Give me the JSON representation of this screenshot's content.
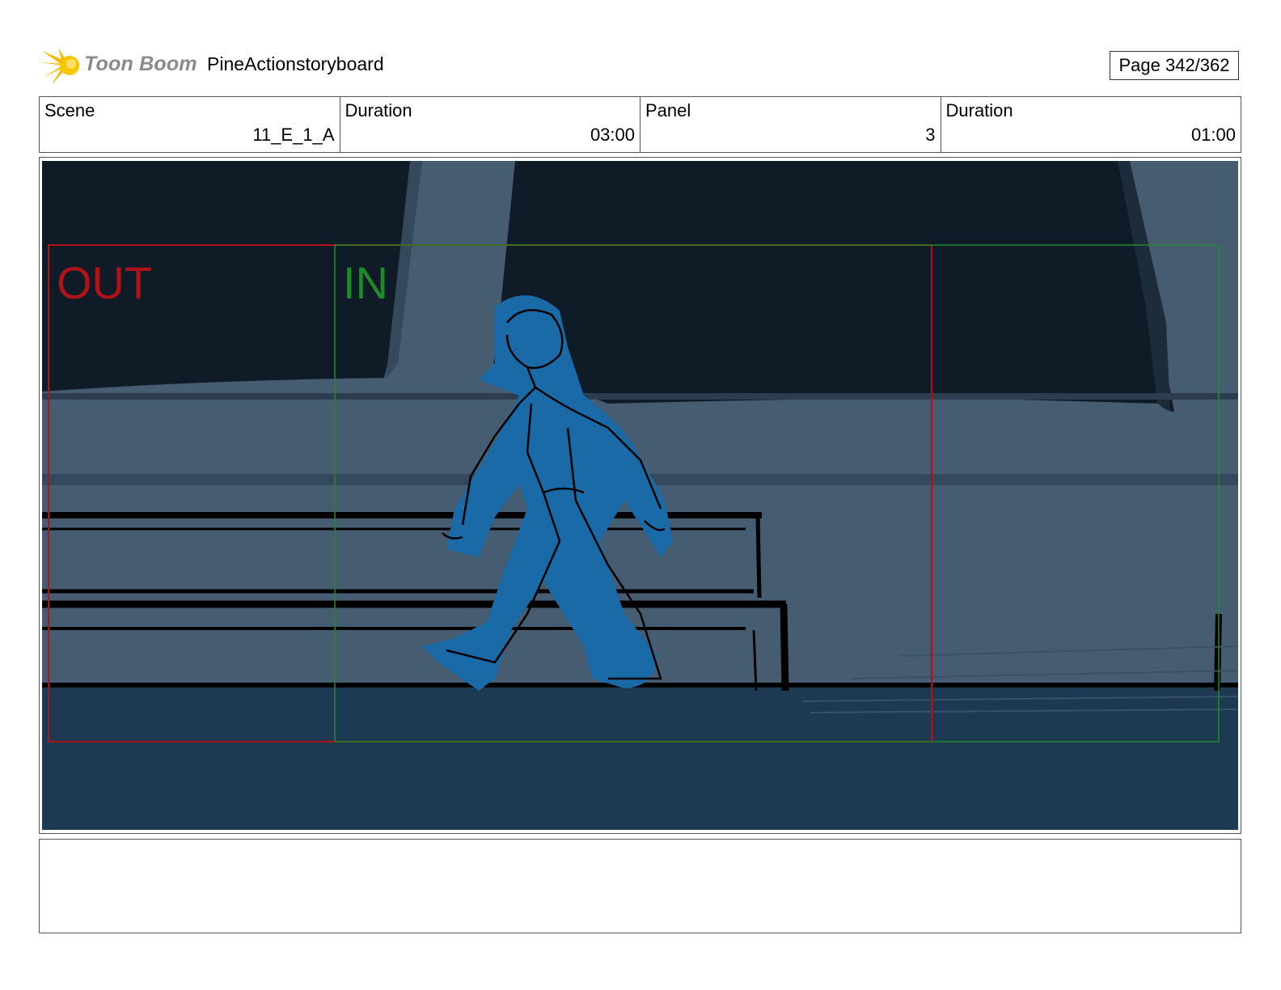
{
  "header": {
    "logo_text": "Toon Boom",
    "project_title": "PineActionstoryboard",
    "page": "Page 342/362"
  },
  "info": [
    {
      "label": "Scene",
      "value": "11_E_1_A"
    },
    {
      "label": "Duration",
      "value": "03:00"
    },
    {
      "label": "Panel",
      "value": "3"
    },
    {
      "label": "Duration",
      "value": "01:00"
    }
  ],
  "panel": {
    "out_label": "OUT",
    "in_label": "IN",
    "colors": {
      "sky": "#0f1c28",
      "wall": "#455c71",
      "floor": "#1d3a52",
      "figure": "#1a6aa8",
      "out_frame": "#b0121a",
      "in_frame": "#1e8a2a"
    }
  },
  "notes": {
    "text": ""
  }
}
